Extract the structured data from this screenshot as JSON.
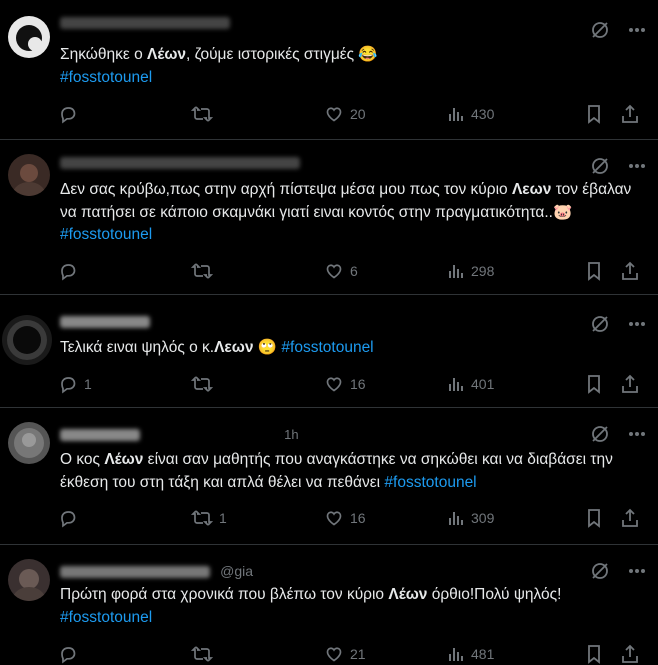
{
  "tweets": [
    {
      "header_partial": "@...",
      "before": "Σηκώθηκε ο ",
      "bold": "Λέων",
      "after": ", ζούμε ιστορικές στιγμές 😂",
      "hashtag": "#fosstotounel",
      "replies": "",
      "retweets": "",
      "likes": "20",
      "views": "430"
    },
    {
      "header_partial": "",
      "text": "Δεν σας κρύβω,πως στην αρχή πίστεψα μέσα μου πως τον κύριο ",
      "bold": "Λεων",
      "after": " τον έβαλαν να πατήσει σε κάποιο σκαμνάκι γιατί ειναι κοντός στην πραγματικότητα..🐷",
      "hashtag": "#fosstotounel",
      "replies": "",
      "retweets": "",
      "likes": "6",
      "views": "298"
    },
    {
      "header_partial": "",
      "before": "Τελικά ειναι ψηλός ο κ.",
      "bold": "Λεων",
      "after": " 🙄 ",
      "hashtag": "#fosstotounel",
      "replies": "1",
      "retweets": "",
      "likes": "16",
      "views": "401"
    },
    {
      "header_partial": "1h",
      "before": "Ο κος ",
      "bold": "Λέων",
      "after": " είναι σαν μαθητής που αναγκάστηκε να σηκώθει και να  διαβάσει την έκθεση του στη τάξη και απλά θέλει να πεθάνει ",
      "hashtag": "#fosstotounel",
      "replies": "",
      "retweets": "1",
      "likes": "16",
      "views": "309"
    },
    {
      "header_partial": "@gia",
      "before": "Πρώτη φορά στα χρονικά που βλέπω τον κύριο ",
      "bold": "Λέων",
      "after": " όρθιο!Πολύ ψηλός!",
      "hashtag": "#fosstotounel",
      "replies": "",
      "retweets": "",
      "likes": "21",
      "views": "481"
    }
  ],
  "colors": {
    "background": "#000000",
    "text": "#e7e9ea",
    "muted": "#71767b",
    "hashtag": "#1d9bf0",
    "divider": "#2f3336"
  }
}
